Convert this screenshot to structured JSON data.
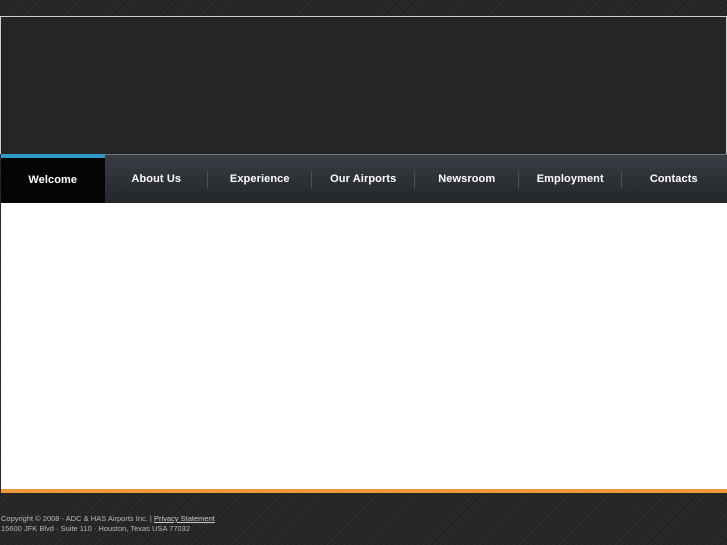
{
  "nav": {
    "items": [
      {
        "label": "Welcome",
        "active": true
      },
      {
        "label": "About Us",
        "active": false
      },
      {
        "label": "Experience",
        "active": false
      },
      {
        "label": "Our Airports",
        "active": false
      },
      {
        "label": "Newsroom",
        "active": false
      },
      {
        "label": "Employment",
        "active": false
      },
      {
        "label": "Contacts",
        "active": false
      }
    ]
  },
  "footer": {
    "copyright": "Copyright © 2008 - ADC & HAS Airports Inc. |",
    "privacy_link": "Privacy Statement",
    "address": "15600 JFK Blvd · Suite 110 · Houston, Texas USA 77032"
  },
  "colors": {
    "accent_blue": "#2e9bc6",
    "accent_orange": "#f19a3a",
    "background": "#252525"
  }
}
